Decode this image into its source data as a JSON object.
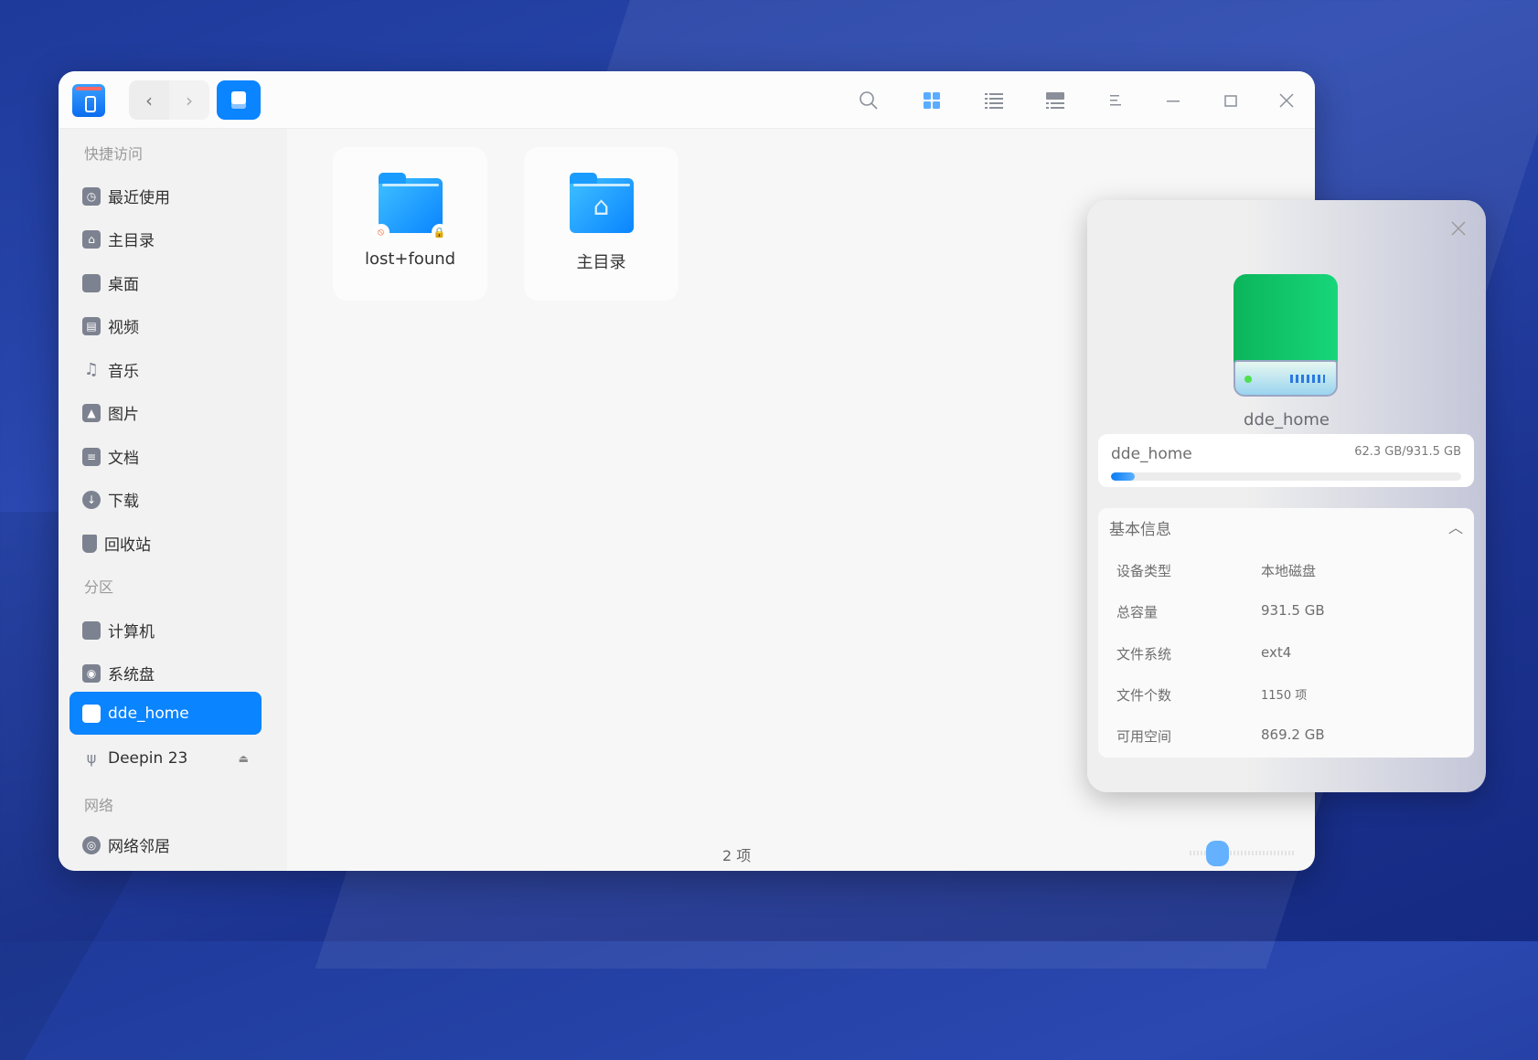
{
  "window": {
    "nav_back": "‹",
    "nav_forward": "›"
  },
  "sidebar": {
    "sections": [
      "快捷访问",
      "分区",
      "网络"
    ],
    "quick": [
      {
        "label": "最近使用",
        "icon": "clock-icon"
      },
      {
        "label": "主目录",
        "icon": "home-icon"
      },
      {
        "label": "桌面",
        "icon": "desktop-icon"
      },
      {
        "label": "视频",
        "icon": "video-icon"
      },
      {
        "label": "音乐",
        "icon": "music-icon"
      },
      {
        "label": "图片",
        "icon": "picture-icon"
      },
      {
        "label": "文档",
        "icon": "document-icon"
      },
      {
        "label": "下载",
        "icon": "download-icon"
      },
      {
        "label": "回收站",
        "icon": "trash-icon"
      }
    ],
    "partitions": [
      {
        "label": "计算机",
        "icon": "computer-icon"
      },
      {
        "label": "系统盘",
        "icon": "system-disk-icon"
      },
      {
        "label": "dde_home",
        "icon": "disk-icon",
        "selected": true
      },
      {
        "label": "Deepin 23",
        "icon": "usb-icon"
      }
    ],
    "network": [
      {
        "label": "网络邻居",
        "icon": "network-icon"
      }
    ]
  },
  "files": [
    {
      "name": "lost+found",
      "icon": "folder-locked-icon"
    },
    {
      "name": "主目录",
      "icon": "home-folder-icon"
    }
  ],
  "status": {
    "count": "2 项",
    "zoom_level": 0.2
  },
  "panel": {
    "device_name": "dde_home",
    "usage": {
      "name": "dde_home",
      "text": "62.3 GB/931.5 GB",
      "fraction": 0.067
    },
    "info_title": "基本信息",
    "rows": [
      {
        "label": "设备类型",
        "value": "本地磁盘"
      },
      {
        "label": "总容量",
        "value": "931.5 GB"
      },
      {
        "label": "文件系统",
        "value": "ext4"
      },
      {
        "label": "文件个数",
        "value": "1150 项"
      },
      {
        "label": "可用空间",
        "value": "869.2 GB"
      }
    ]
  },
  "colors": {
    "accent": "#0a84ff",
    "disk": "#0bb55a"
  }
}
